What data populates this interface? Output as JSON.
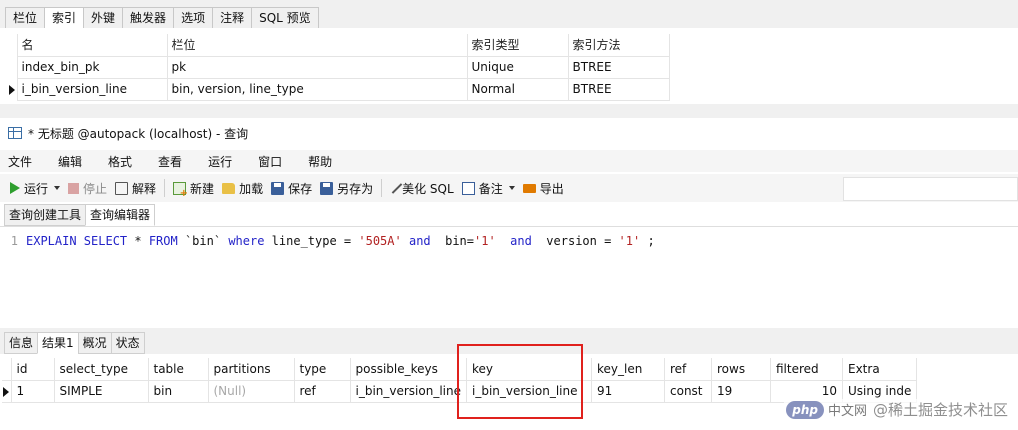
{
  "index_designer": {
    "tabs": [
      "栏位",
      "索引",
      "外键",
      "触发器",
      "选项",
      "注释",
      "SQL 预览"
    ],
    "active_tab": "索引",
    "columns": [
      "名",
      "栏位",
      "索引类型",
      "索引方法"
    ],
    "rows": [
      [
        "index_bin_pk",
        "pk",
        "Unique",
        "BTREE"
      ],
      [
        "i_bin_version_line",
        "bin, version, line_type",
        "Normal",
        "BTREE"
      ]
    ]
  },
  "query_window": {
    "title": "* 无标题 @autopack (localhost) - 查询",
    "menu": [
      "文件",
      "编辑",
      "格式",
      "查看",
      "运行",
      "窗口",
      "帮助"
    ],
    "toolbar": {
      "run": "运行",
      "stop": "停止",
      "explain": "解释",
      "new": "新建",
      "load": "加载",
      "save": "保存",
      "save_as": "另存为",
      "beautify": "美化 SQL",
      "note": "备注",
      "export": "导出"
    },
    "sub_tabs": [
      "查询创建工具",
      "查询编辑器"
    ],
    "active_sub_tab": "查询编辑器",
    "editor": {
      "line_number": "1",
      "tokens": [
        {
          "t": "EXPLAIN SELECT ",
          "c": "kw"
        },
        {
          "t": "* ",
          "c": "plain"
        },
        {
          "t": "FROM ",
          "c": "kw"
        },
        {
          "t": "`bin` ",
          "c": "plain"
        },
        {
          "t": "where ",
          "c": "kw"
        },
        {
          "t": "line_type = ",
          "c": "plain"
        },
        {
          "t": "'505A'",
          "c": "str"
        },
        {
          "t": " ",
          "c": "plain"
        },
        {
          "t": "and",
          "c": "kw"
        },
        {
          "t": "  bin=",
          "c": "plain"
        },
        {
          "t": "'1'",
          "c": "str"
        },
        {
          "t": "  ",
          "c": "plain"
        },
        {
          "t": "and",
          "c": "kw"
        },
        {
          "t": "  version = ",
          "c": "plain"
        },
        {
          "t": "'1'",
          "c": "str"
        },
        {
          "t": " ;",
          "c": "plain"
        }
      ]
    }
  },
  "results": {
    "tabs": [
      "信息",
      "结果1",
      "概况",
      "状态"
    ],
    "active_tab": "结果1",
    "columns": [
      "id",
      "select_type",
      "table",
      "partitions",
      "type",
      "possible_keys",
      "key",
      "key_len",
      "ref",
      "rows",
      "filtered",
      "Extra"
    ],
    "rows": [
      [
        "1",
        "SIMPLE",
        "bin",
        "(Null)",
        "ref",
        "i_bin_version_line",
        "i_bin_version_line",
        "91",
        "const",
        "19",
        "10",
        "Using inde"
      ]
    ]
  },
  "watermark": {
    "logo": "php",
    "logo_cn": "中文网",
    "text": "@稀土掘金技术社区"
  },
  "colors": {
    "highlight": "#e0211d",
    "keyword": "#2323c8",
    "string": "#b22222"
  }
}
